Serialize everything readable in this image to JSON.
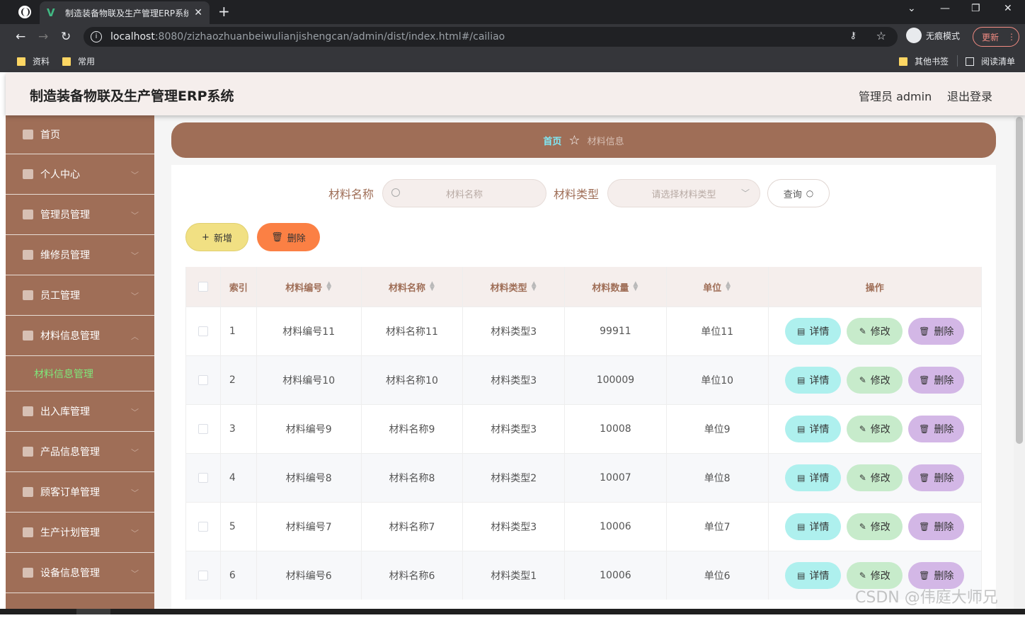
{
  "browser": {
    "tab_title": "制造装备物联及生产管理ERP系统",
    "url_host": "localhost",
    "url_path": ":8080/zizhaozhuanbeiwulianjishengcan/admin/dist/index.html#/cailiao",
    "incognito_label": "无痕模式",
    "update_label": "更新",
    "bookmarks": [
      "资料",
      "常用"
    ],
    "other_bookmarks": "其他书签",
    "reading_list": "阅读清单"
  },
  "header": {
    "title": "制造装备物联及生产管理ERP系统",
    "admin": "管理员 admin",
    "logout": "退出登录"
  },
  "sidebar": {
    "items": [
      {
        "label": "首页"
      },
      {
        "label": "个人中心"
      },
      {
        "label": "管理员管理"
      },
      {
        "label": "维修员管理"
      },
      {
        "label": "员工管理"
      },
      {
        "label": "材料信息管理"
      },
      {
        "label": "出入库管理"
      },
      {
        "label": "产品信息管理"
      },
      {
        "label": "顾客订单管理"
      },
      {
        "label": "生产计划管理"
      },
      {
        "label": "设备信息管理"
      }
    ],
    "submenu": "材料信息管理"
  },
  "breadcrumb": {
    "home": "首页",
    "current": "材料信息"
  },
  "search": {
    "name_label": "材料名称",
    "name_placeholder": "材料名称",
    "type_label": "材料类型",
    "type_placeholder": "请选择材料类型",
    "query": "查询"
  },
  "actions": {
    "add": "新增",
    "delete": "删除"
  },
  "table": {
    "headers": [
      "索引",
      "材料编号",
      "材料名称",
      "材料类型",
      "材料数量",
      "单位",
      "操作"
    ],
    "rows": [
      [
        "1",
        "材料编号11",
        "材料名称11",
        "材料类型3",
        "99911",
        "单位11"
      ],
      [
        "2",
        "材料编号10",
        "材料名称10",
        "材料类型3",
        "100009",
        "单位10"
      ],
      [
        "3",
        "材料编号9",
        "材料名称9",
        "材料类型3",
        "10008",
        "单位9"
      ],
      [
        "4",
        "材料编号8",
        "材料名称8",
        "材料类型2",
        "10007",
        "单位8"
      ],
      [
        "5",
        "材料编号7",
        "材料名称7",
        "材料类型3",
        "10006",
        "单位7"
      ],
      [
        "6",
        "材料编号6",
        "材料名称6",
        "材料类型1",
        "10006",
        "单位6"
      ]
    ],
    "op_detail": "详情",
    "op_edit": "修改",
    "op_delete": "删除"
  },
  "watermark": "CSDN @伟庭大师兄"
}
